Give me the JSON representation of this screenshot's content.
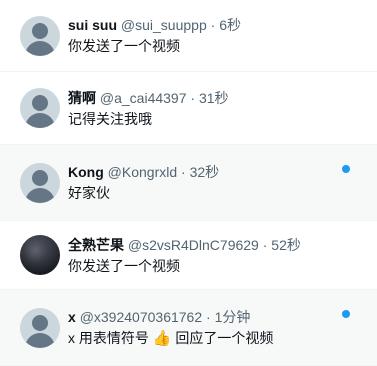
{
  "conversations": [
    {
      "name": "sui suu",
      "handle": "@sui_suuppp",
      "sep": "·",
      "time": "6秒",
      "preview": "你发送了一个视频",
      "unread": false
    },
    {
      "name": "猜啊",
      "handle": "@a_cai44397",
      "sep": "·",
      "time": "31秒",
      "preview": "记得关注我哦",
      "unread": false
    },
    {
      "name": "Kong",
      "handle": "@Kongrxld",
      "sep": "·",
      "time": "32秒",
      "preview": "好家伙",
      "unread": true
    },
    {
      "name": "全熟芒果",
      "handle": "@s2vsR4DlnC79629",
      "sep": "·",
      "time": "52秒",
      "preview": "你发送了一个视频",
      "unread": false
    },
    {
      "name": "x",
      "handle": "@x3924070361762",
      "sep": "·",
      "time": "1分钟",
      "preview_prefix": "x 用表情符号",
      "preview_emoji": "👍",
      "preview_suffix": "回应了一个视频",
      "unread": true
    }
  ],
  "colors": {
    "accent": "#1d9bf0",
    "unread_bg": "#f7f9f9",
    "muted_text": "#536471"
  },
  "icons": {
    "default_avatar": "user-silhouette-icon",
    "unread": "unread-dot-icon"
  }
}
